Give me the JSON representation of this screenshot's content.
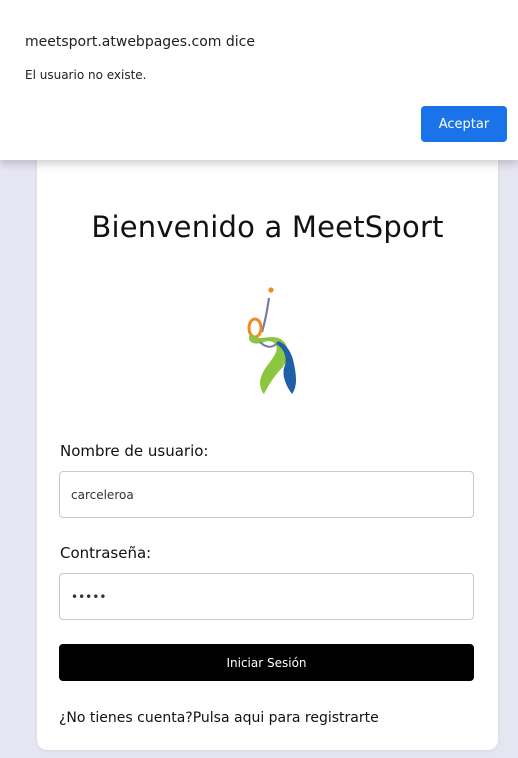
{
  "dialog": {
    "origin": "meetsport.atwebpages.com dice",
    "message": "El usuario no existe.",
    "accept_label": "Aceptar",
    "accent_color": "#1a73e8"
  },
  "page": {
    "background_color": "#e6e5f2",
    "title": "Bienvenido a MeetSport",
    "logo_icon": "tennis-player-icon",
    "form": {
      "username_label": "Nombre de usuario:",
      "username_value": "carceleroa",
      "password_label": "Contraseña:",
      "password_value": "•••••",
      "submit_label": "Iniciar Sesión"
    },
    "register": {
      "prompt": "¿No tienes cuenta?",
      "link": "Pulsa aqui para registrarte"
    }
  }
}
